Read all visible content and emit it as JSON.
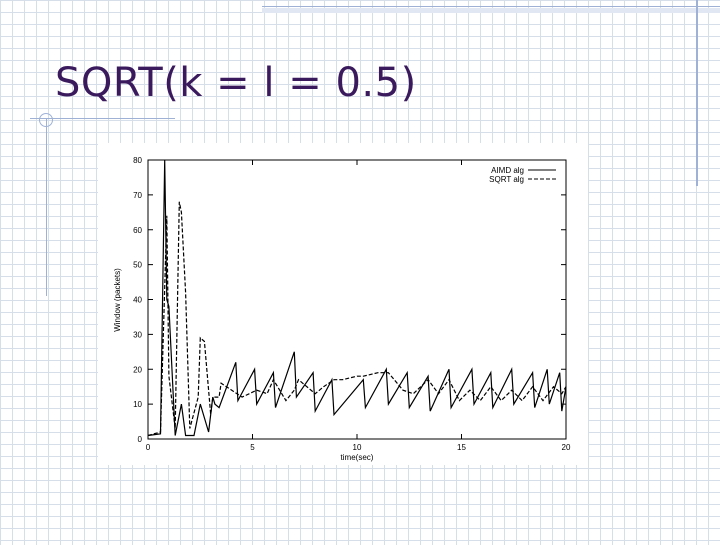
{
  "slide": {
    "title": "SQRT(k = l = 0.5)"
  },
  "colors": {
    "title": "#3a1a5c",
    "accent_line": "#9fb2d6",
    "plot_line": "#000000"
  },
  "chart_data": {
    "type": "line",
    "title": "",
    "xlabel": "time(sec)",
    "ylabel": "Window (packets)",
    "xlim": [
      0,
      20
    ],
    "ylim": [
      0,
      80
    ],
    "x_ticks": [
      "0",
      "5",
      "10",
      "15",
      "20"
    ],
    "y_ticks": [
      "0",
      "10",
      "20",
      "30",
      "40",
      "50",
      "60",
      "70",
      "80"
    ],
    "grid": false,
    "legend_position": "top-right",
    "series": [
      {
        "name": "AIMD alg",
        "style": "solid",
        "points": [
          [
            0,
            1
          ],
          [
            0.6,
            1.5
          ],
          [
            0.8,
            80
          ],
          [
            0.9,
            40
          ],
          [
            1.0,
            38
          ],
          [
            1.3,
            1
          ],
          [
            1.6,
            10
          ],
          [
            1.8,
            1
          ],
          [
            2.2,
            1
          ],
          [
            2.5,
            10
          ],
          [
            2.9,
            2
          ],
          [
            3.1,
            12
          ],
          [
            3.2,
            10
          ],
          [
            3.4,
            9
          ],
          [
            4.2,
            22
          ],
          [
            4.3,
            11
          ],
          [
            5.1,
            20
          ],
          [
            5.2,
            10
          ],
          [
            6.0,
            19
          ],
          [
            6.1,
            9
          ],
          [
            7.0,
            25
          ],
          [
            7.1,
            12
          ],
          [
            7.9,
            19
          ],
          [
            8.0,
            8
          ],
          [
            8.8,
            17
          ],
          [
            8.9,
            7
          ],
          [
            10.3,
            17
          ],
          [
            10.4,
            9
          ],
          [
            11.4,
            20
          ],
          [
            11.5,
            10
          ],
          [
            12.4,
            19
          ],
          [
            12.5,
            9
          ],
          [
            13.4,
            18
          ],
          [
            13.5,
            8
          ],
          [
            14.4,
            20
          ],
          [
            14.5,
            9
          ],
          [
            15.5,
            20
          ],
          [
            15.6,
            10
          ],
          [
            16.4,
            19
          ],
          [
            16.5,
            9
          ],
          [
            17.4,
            20
          ],
          [
            17.5,
            10
          ],
          [
            18.4,
            19
          ],
          [
            18.5,
            9
          ],
          [
            19.1,
            20
          ],
          [
            19.2,
            10
          ],
          [
            19.7,
            19
          ],
          [
            19.8,
            8
          ],
          [
            20,
            15
          ]
        ]
      },
      {
        "name": "SQRT alg",
        "style": "dashed",
        "points": [
          [
            0,
            1
          ],
          [
            0.6,
            2
          ],
          [
            0.9,
            64
          ],
          [
            1.0,
            18
          ],
          [
            1.3,
            3
          ],
          [
            1.5,
            68
          ],
          [
            1.6,
            65
          ],
          [
            1.8,
            42
          ],
          [
            2.0,
            3
          ],
          [
            2.4,
            12
          ],
          [
            2.5,
            29
          ],
          [
            2.7,
            28
          ],
          [
            3.0,
            7
          ],
          [
            3.1,
            12
          ],
          [
            3.4,
            12
          ],
          [
            3.5,
            16
          ],
          [
            4.5,
            12
          ],
          [
            5.2,
            14
          ],
          [
            5.7,
            13
          ],
          [
            6.0,
            17
          ],
          [
            6.3,
            14
          ],
          [
            6.6,
            11
          ],
          [
            7.0,
            14
          ],
          [
            7.2,
            17
          ],
          [
            8.0,
            13
          ],
          [
            8.4,
            15
          ],
          [
            8.9,
            17
          ],
          [
            9.3,
            17
          ],
          [
            10.0,
            18
          ],
          [
            10.3,
            18
          ],
          [
            11.0,
            19
          ],
          [
            11.5,
            19
          ],
          [
            12.2,
            14
          ],
          [
            12.7,
            13
          ],
          [
            13.4,
            17
          ],
          [
            13.9,
            13
          ],
          [
            14.4,
            17
          ],
          [
            14.9,
            11
          ],
          [
            15.4,
            14
          ],
          [
            15.9,
            11
          ],
          [
            16.4,
            15
          ],
          [
            16.9,
            11
          ],
          [
            17.4,
            14
          ],
          [
            17.9,
            11
          ],
          [
            18.4,
            15
          ],
          [
            18.9,
            11
          ],
          [
            19.4,
            15
          ],
          [
            19.8,
            13
          ],
          [
            20,
            15
          ]
        ]
      }
    ]
  }
}
